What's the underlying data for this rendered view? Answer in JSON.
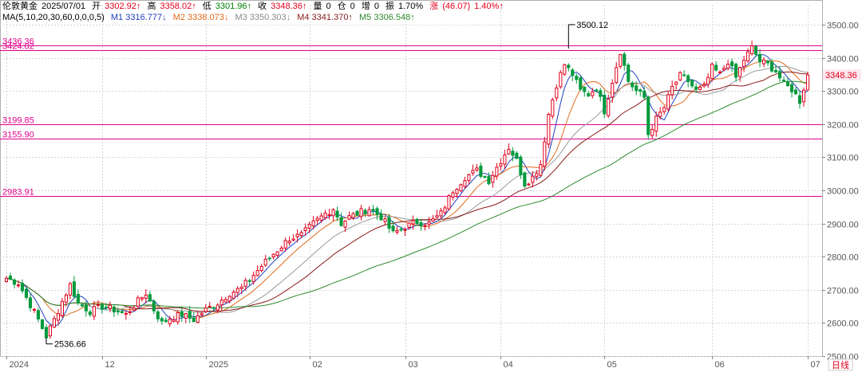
{
  "header": {
    "symbol": "伦敦黄金",
    "date": "2025/07/01",
    "open_label": "开",
    "open": "3302.92↑",
    "high_label": "高",
    "high": "3358.02↑",
    "low_label": "低",
    "low": "3301.96↑",
    "close_label": "收",
    "close": "3348.36↑",
    "volume_label": "量",
    "volume": "0",
    "oi_label": "仓",
    "oi": "0",
    "inc_label": "增",
    "inc": "0",
    "amp_label": "振",
    "amp": "1.70%",
    "chg_label": "涨",
    "chg": "(46.07)",
    "chg_pct": "1.40%↑"
  },
  "ma_header": {
    "params": "MA(5,10,20,30,60,0,0,0,5)",
    "m1": "M1 3316.777↓",
    "m2": "M2 3338.073↓",
    "m3": "M3 3350.303↓",
    "m4": "M4 3341.370↑",
    "m5": "M5 3306.548↑"
  },
  "colors": {
    "up": "#e0001b",
    "down": "#009a3c",
    "ma1": "#1f3fbf",
    "ma2": "#e06a1a",
    "ma3": "#9a9a9a",
    "ma4": "#8b1a1a",
    "ma5": "#2e8b2e",
    "hline": "#e0008c",
    "price_tag_bg": "#fde8ef"
  },
  "chart_data": {
    "type": "candlestick",
    "ylim": [
      2500,
      3560
    ],
    "y_ticks": [
      "2500.00",
      "2600.00",
      "2700.00",
      "2800.00",
      "2900.00",
      "3000.00",
      "3100.00",
      "3200.00",
      "3300.00",
      "3400.00",
      "3500.00"
    ],
    "x_labels": [
      "2024",
      "12",
      "2025",
      "02",
      "03",
      "04",
      "05",
      "06",
      "07"
    ],
    "x_label_index": [
      0,
      24,
      50,
      76,
      100,
      124,
      150,
      177,
      201
    ],
    "bar_count": 202,
    "hlines": [
      {
        "label": "3436.36",
        "value": 3436.36
      },
      {
        "label": "3424.02",
        "value": 3424.02
      },
      {
        "label": "3199.85",
        "value": 3199.85
      },
      {
        "label": "3155.90",
        "value": 3155.9
      },
      {
        "label": "2983.91",
        "value": 2983.91
      }
    ],
    "annotations": [
      {
        "label": "3500.12",
        "value": 3500.12,
        "index": 141
      },
      {
        "label": "2536.66",
        "value": 2536.66,
        "index": 10
      }
    ],
    "last_price": "3348.36",
    "period_label": "日线",
    "anchors": [
      [
        0,
        2735
      ],
      [
        3,
        2720
      ],
      [
        6,
        2655
      ],
      [
        8,
        2610
      ],
      [
        10,
        2560
      ],
      [
        12,
        2610
      ],
      [
        14,
        2665
      ],
      [
        16,
        2715
      ],
      [
        18,
        2660
      ],
      [
        21,
        2635
      ],
      [
        24,
        2650
      ],
      [
        27,
        2640
      ],
      [
        30,
        2625
      ],
      [
        33,
        2665
      ],
      [
        35,
        2690
      ],
      [
        37,
        2640
      ],
      [
        39,
        2600
      ],
      [
        41,
        2615
      ],
      [
        44,
        2625
      ],
      [
        47,
        2610
      ],
      [
        50,
        2640
      ],
      [
        53,
        2660
      ],
      [
        56,
        2690
      ],
      [
        59,
        2705
      ],
      [
        62,
        2745
      ],
      [
        65,
        2785
      ],
      [
        68,
        2820
      ],
      [
        71,
        2855
      ],
      [
        74,
        2865
      ],
      [
        77,
        2900
      ],
      [
        80,
        2930
      ],
      [
        82,
        2945
      ],
      [
        84,
        2900
      ],
      [
        86,
        2920
      ],
      [
        88,
        2930
      ],
      [
        91,
        2945
      ],
      [
        94,
        2920
      ],
      [
        97,
        2870
      ],
      [
        100,
        2890
      ],
      [
        103,
        2905
      ],
      [
        106,
        2900
      ],
      [
        109,
        2930
      ],
      [
        112,
        3000
      ],
      [
        115,
        3040
      ],
      [
        118,
        3060
      ],
      [
        121,
        3030
      ],
      [
        124,
        3090
      ],
      [
        126,
        3130
      ],
      [
        128,
        3090
      ],
      [
        130,
        3020
      ],
      [
        132,
        3040
      ],
      [
        134,
        3080
      ],
      [
        136,
        3230
      ],
      [
        138,
        3320
      ],
      [
        140,
        3380
      ],
      [
        142,
        3350
      ],
      [
        144,
        3300
      ],
      [
        146,
        3290
      ],
      [
        148,
        3310
      ],
      [
        150,
        3240
      ],
      [
        152,
        3330
      ],
      [
        154,
        3420
      ],
      [
        156,
        3330
      ],
      [
        158,
        3300
      ],
      [
        160,
        3280
      ],
      [
        161,
        3170
      ],
      [
        163,
        3215
      ],
      [
        165,
        3250
      ],
      [
        167,
        3310
      ],
      [
        169,
        3345
      ],
      [
        171,
        3330
      ],
      [
        173,
        3300
      ],
      [
        175,
        3310
      ],
      [
        177,
        3370
      ],
      [
        179,
        3350
      ],
      [
        181,
        3390
      ],
      [
        183,
        3340
      ],
      [
        185,
        3395
      ],
      [
        187,
        3430
      ],
      [
        189,
        3390
      ],
      [
        191,
        3380
      ],
      [
        193,
        3360
      ],
      [
        195,
        3320
      ],
      [
        197,
        3305
      ],
      [
        199,
        3270
      ],
      [
        201,
        3348
      ]
    ]
  }
}
